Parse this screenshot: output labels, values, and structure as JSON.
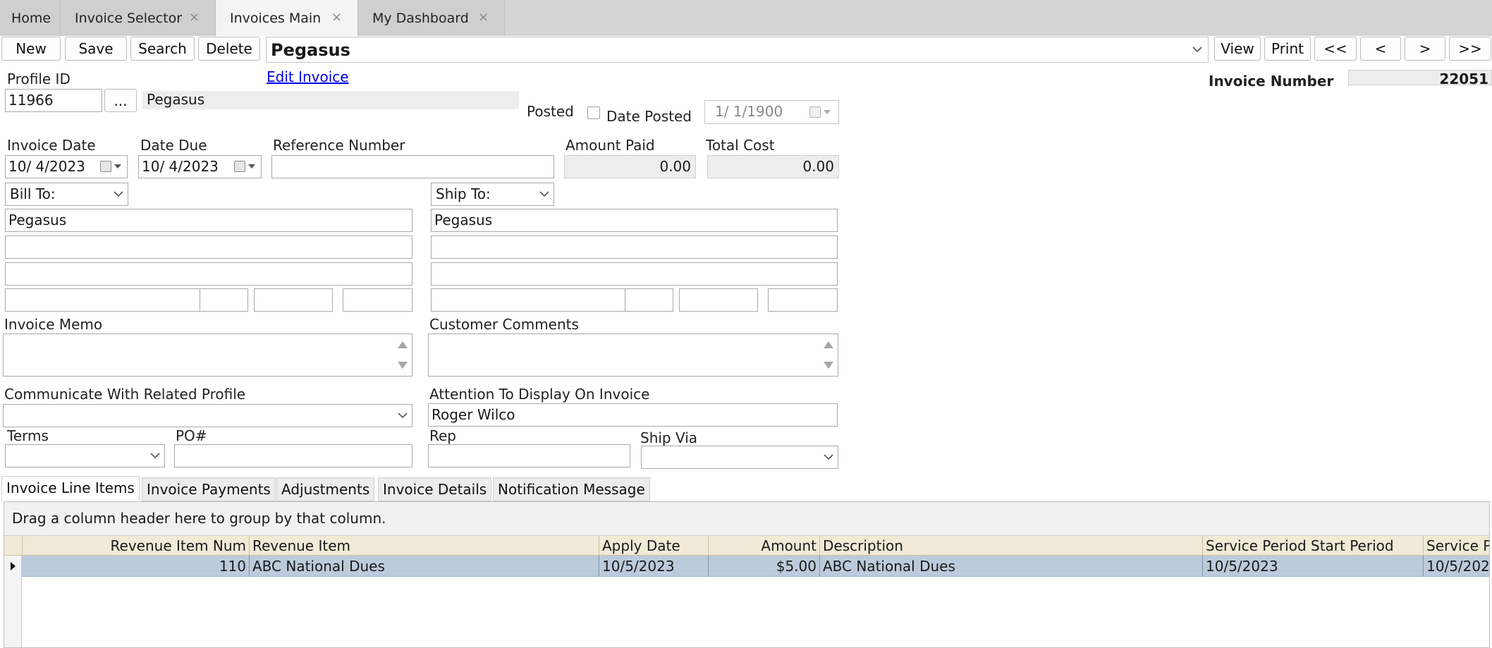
{
  "tabs": [
    {
      "label": "Home",
      "closable": false
    },
    {
      "label": "Invoice Selector",
      "closable": true
    },
    {
      "label": "Invoices Main",
      "closable": true,
      "active": true
    },
    {
      "label": "My Dashboard",
      "closable": true
    }
  ],
  "close_glyph": "×",
  "toolbar": {
    "new_label": "New",
    "save_label": "Save",
    "search_label": "Search",
    "delete_label": "Delete",
    "record_select_value": "Pegasus",
    "view_label": "View",
    "print_label": "Print",
    "first_label": "<<",
    "prev_label": "<",
    "next_label": ">",
    "last_label": ">>"
  },
  "header": {
    "profile_id_label": "Profile ID",
    "profile_id_value": "11966",
    "lookup_label": "...",
    "profile_name": "Pegasus",
    "edit_invoice_link": "Edit Invoice",
    "posted_label": "Posted",
    "date_posted_label": "Date Posted",
    "date_posted_value": "1/  1/1900",
    "invoice_number_label": "Invoice Number",
    "invoice_number_value": "22051"
  },
  "dates": {
    "invoice_date_label": "Invoice Date",
    "invoice_date_value": "10/  4/2023",
    "date_due_label": "Date Due",
    "date_due_value": "10/  4/2023",
    "reference_number_label": "Reference Number",
    "reference_number_value": "",
    "amount_paid_label": "Amount Paid",
    "amount_paid_value": "0.00",
    "total_cost_label": "Total Cost",
    "total_cost_value": "0.00"
  },
  "bill_to": {
    "select_label": "Bill To:",
    "name": "Pegasus"
  },
  "ship_to": {
    "select_label": "Ship To:",
    "name": "Pegasus"
  },
  "memo": {
    "invoice_memo_label": "Invoice Memo",
    "customer_comments_label": "Customer Comments"
  },
  "communication": {
    "related_profile_label": "Communicate With Related Profile",
    "attention_label": "Attention To Display On Invoice",
    "attention_value": "Roger Wilco"
  },
  "terms": {
    "terms_label": "Terms",
    "po_label": "PO#",
    "rep_label": "Rep",
    "ship_via_label": "Ship Via"
  },
  "subtabs": [
    {
      "label": "Invoice Line Items",
      "active": true
    },
    {
      "label": "Invoice Payments"
    },
    {
      "label": "Adjustments"
    },
    {
      "label": "Invoice Details"
    },
    {
      "label": "Notification Message"
    }
  ],
  "grid": {
    "group_hint": "Drag a column header here to group by that column.",
    "columns": [
      "Revenue Item Num",
      "Revenue Item",
      "Apply Date",
      "Amount",
      "Description",
      "Service Period Start Period",
      "Service Pe"
    ],
    "rows": [
      [
        "110",
        "ABC National Dues",
        "10/5/2023",
        "$5.00",
        "ABC National Dues",
        "10/5/2023",
        "10/5/202"
      ]
    ]
  }
}
